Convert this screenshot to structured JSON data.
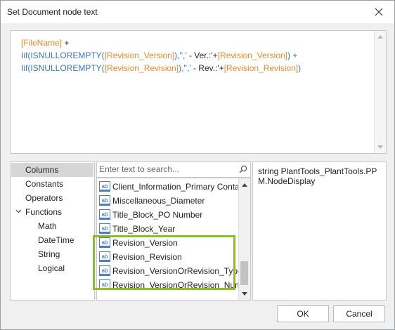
{
  "window": {
    "title": "Set Document node text",
    "close_label": "close"
  },
  "expression": {
    "line1": {
      "field": "[FileName]",
      "rest": " +"
    },
    "line2": {
      "fn": "Iif(ISNULLOREMPTY(",
      "field_a": "[Revision_Version]",
      "mid": "),'','",
      "lit": " - Ver.:'+",
      "field_b": "[Revision_Version]",
      "end": ") +"
    },
    "line3": {
      "fn": "Iif(ISNULLOREMPTY(",
      "field_a": "[Revision_Revision]",
      "mid": "),'','",
      "lit": " - Rev.:'+",
      "field_b": "[Revision_Revision]",
      "end": ")"
    }
  },
  "categories": {
    "items": [
      {
        "label": "Columns",
        "selected": true
      },
      {
        "label": "Constants"
      },
      {
        "label": "Operators"
      },
      {
        "label": "Functions",
        "expanded": true
      },
      {
        "label": "Math"
      },
      {
        "label": "DateTime"
      },
      {
        "label": "String"
      },
      {
        "label": "Logical"
      }
    ]
  },
  "search": {
    "placeholder": "Enter text to search..."
  },
  "fields": {
    "icon_text": "ab",
    "items": [
      "Client_Information_Primary Contact",
      "Miscellaneous_Diameter",
      "Title_Block_PO Number",
      "Title_Block_Year",
      "Revision_Version",
      "Revision_Revision",
      "Revision_VersionOrRevision_Type",
      "Revision_VersionOrRevision_Num..."
    ]
  },
  "description": {
    "text": "string PlantTools_PlantTools.PPM.NodeDisplay"
  },
  "buttons": {
    "ok": "OK",
    "cancel": "Cancel"
  },
  "colors": {
    "field": "#e8892f",
    "function": "#3a78b8",
    "highlight": "#8cbd2c"
  }
}
